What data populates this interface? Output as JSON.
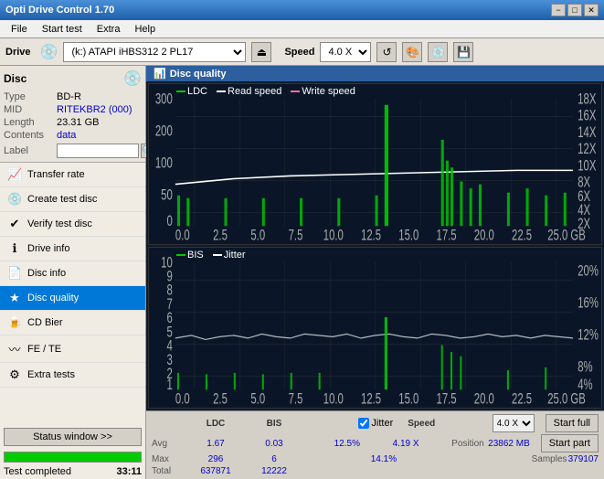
{
  "app": {
    "title": "Opti Drive Control 1.70",
    "titlebar_controls": [
      "−",
      "□",
      "✕"
    ]
  },
  "menu": {
    "items": [
      "File",
      "Start test",
      "Extra",
      "Help"
    ]
  },
  "drive_bar": {
    "label": "Drive",
    "drive_value": "(k:) ATAPI iHBS312  2 PL17",
    "speed_label": "Speed",
    "speed_value": "4.0 X",
    "icon_eject": "⏏",
    "icon_refresh": "↺",
    "icon_paint": "🖌",
    "icon_cd": "💿",
    "icon_save": "💾"
  },
  "disc": {
    "title": "Disc",
    "icon": "💿",
    "rows": [
      {
        "key": "Type",
        "value": "BD-R",
        "blue": false
      },
      {
        "key": "MID",
        "value": "RITEKBR2 (000)",
        "blue": true
      },
      {
        "key": "Length",
        "value": "23.31 GB",
        "blue": false
      },
      {
        "key": "Contents",
        "value": "data",
        "blue": true
      },
      {
        "key": "Label",
        "value": "",
        "blue": false
      }
    ],
    "label_placeholder": ""
  },
  "nav": {
    "items": [
      {
        "id": "transfer-rate",
        "icon": "📈",
        "label": "Transfer rate",
        "active": false
      },
      {
        "id": "create-test-disc",
        "icon": "💿",
        "label": "Create test disc",
        "active": false
      },
      {
        "id": "verify-test-disc",
        "icon": "✔",
        "label": "Verify test disc",
        "active": false
      },
      {
        "id": "drive-info",
        "icon": "ℹ",
        "label": "Drive info",
        "active": false
      },
      {
        "id": "disc-info",
        "icon": "📄",
        "label": "Disc info",
        "active": false
      },
      {
        "id": "disc-quality",
        "icon": "★",
        "label": "Disc quality",
        "active": true
      },
      {
        "id": "cd-bier",
        "icon": "🍺",
        "label": "CD Bier",
        "active": false
      },
      {
        "id": "fe-te",
        "icon": "〰",
        "label": "FE / TE",
        "active": false
      },
      {
        "id": "extra-tests",
        "icon": "⚙",
        "label": "Extra tests",
        "active": false
      }
    ]
  },
  "status_window_btn": "Status window >>",
  "progress": {
    "percent": 100,
    "status_text": "Test completed",
    "time": "33:11"
  },
  "disc_quality_panel": {
    "title": "Disc quality",
    "icon": "📊"
  },
  "legend_upper": {
    "ldc": {
      "label": "LDC",
      "color": "#00cc00"
    },
    "read_speed": {
      "label": "Read speed",
      "color": "#ffffff"
    },
    "write_speed": {
      "label": "Write speed",
      "color": "#ff69b4"
    }
  },
  "legend_lower": {
    "bis": {
      "label": "BIS",
      "color": "#00cc00"
    },
    "jitter": {
      "label": "Jitter",
      "color": "#ffffff"
    }
  },
  "x_labels": [
    "0.0",
    "2.5",
    "5.0",
    "7.5",
    "10.0",
    "12.5",
    "15.0",
    "17.5",
    "20.0",
    "22.5",
    "25.0"
  ],
  "y_upper_left": [
    "300",
    "200",
    "100",
    "50",
    "0"
  ],
  "y_upper_right": [
    "18X",
    "16X",
    "14X",
    "12X",
    "10X",
    "8X",
    "6X",
    "4X",
    "2X"
  ],
  "y_lower_left": [
    "10",
    "9",
    "8",
    "7",
    "6",
    "5",
    "4",
    "3",
    "2",
    "1"
  ],
  "y_lower_right": [
    "20%",
    "16%",
    "12%",
    "8%",
    "4%"
  ],
  "stats": {
    "columns": [
      "LDC",
      "BIS",
      "",
      "Jitter",
      "Speed",
      ""
    ],
    "avg_label": "Avg",
    "max_label": "Max",
    "total_label": "Total",
    "avg_ldc": "1.67",
    "avg_bis": "0.03",
    "avg_jitter": "12.5%",
    "avg_speed": "4.19 X",
    "max_ldc": "296",
    "max_bis": "6",
    "max_jitter": "14.1%",
    "position_label": "Position",
    "position_val": "23862 MB",
    "total_ldc": "637871",
    "total_bis": "12222",
    "samples_label": "Samples",
    "samples_val": "379107",
    "jitter_checked": true,
    "jitter_label": "Jitter",
    "speed_display": "4.0 X",
    "start_full_label": "Start full",
    "start_part_label": "Start part"
  }
}
